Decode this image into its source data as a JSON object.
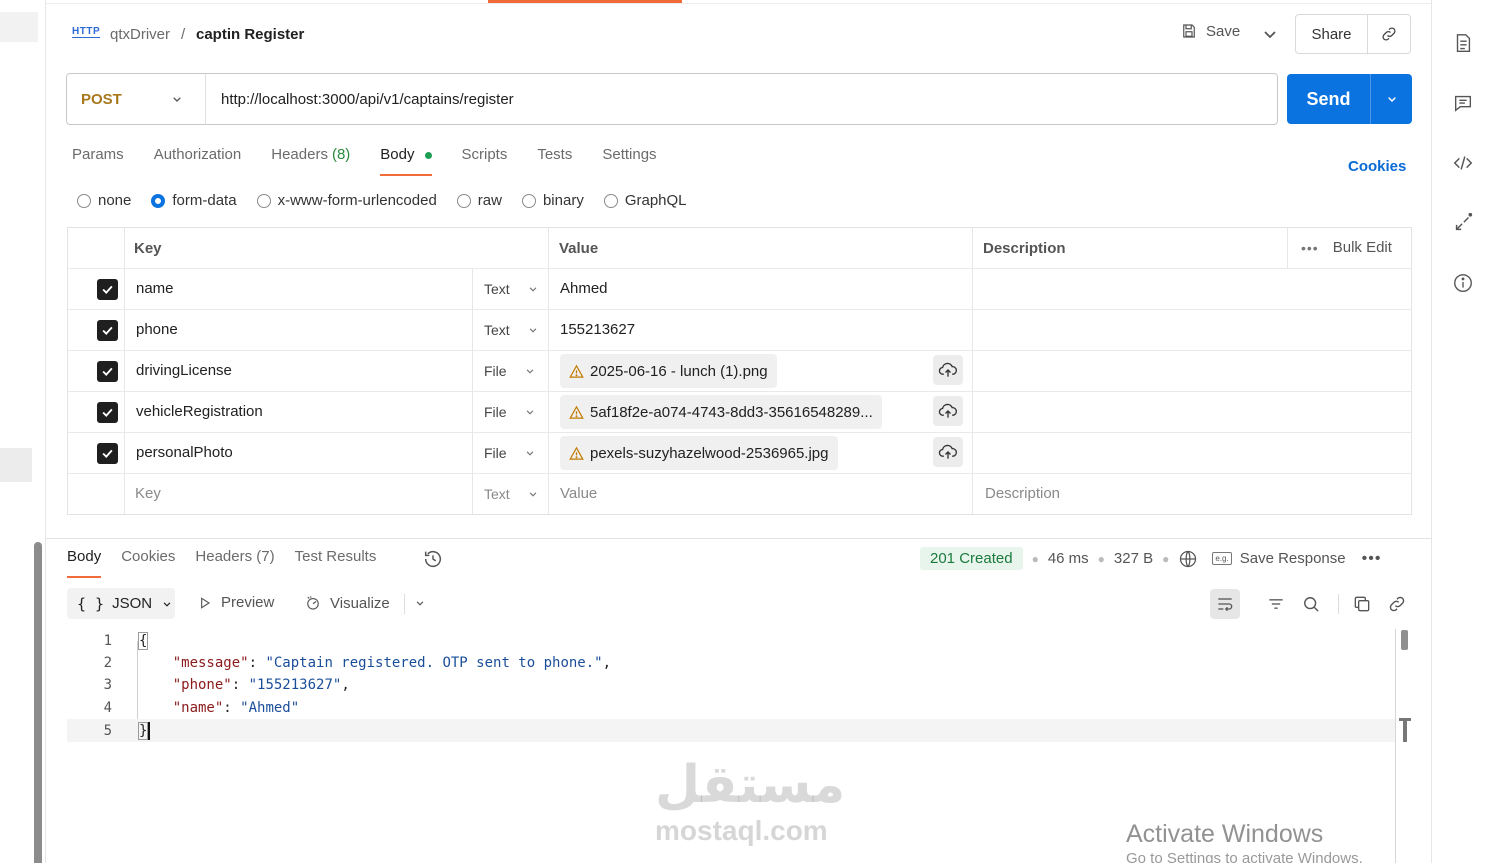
{
  "header": {
    "http_badge": "HTTP",
    "collection": "qtxDriver",
    "separator": "/",
    "request_name": "captin Register",
    "save_label": "Save",
    "share_label": "Share"
  },
  "request": {
    "method": "POST",
    "url": "http://localhost:3000/api/v1/captains/register",
    "send_label": "Send"
  },
  "request_tabs": [
    {
      "label": "Params",
      "count": ""
    },
    {
      "label": "Authorization",
      "count": ""
    },
    {
      "label": "Headers",
      "count": "(8)"
    },
    {
      "label": "Body",
      "count": ""
    },
    {
      "label": "Scripts",
      "count": ""
    },
    {
      "label": "Tests",
      "count": ""
    },
    {
      "label": "Settings",
      "count": ""
    }
  ],
  "cookies_label": "Cookies",
  "body_modes": [
    {
      "label": "none",
      "selected": false
    },
    {
      "label": "form-data",
      "selected": true
    },
    {
      "label": "x-www-form-urlencoded",
      "selected": false
    },
    {
      "label": "raw",
      "selected": false
    },
    {
      "label": "binary",
      "selected": false
    },
    {
      "label": "GraphQL",
      "selected": false
    }
  ],
  "form_table": {
    "headers": {
      "key": "Key",
      "value": "Value",
      "description": "Description",
      "bulk_edit": "Bulk Edit",
      "more": "•••"
    },
    "rows": [
      {
        "key": "name",
        "type": "Text",
        "value": "Ahmed",
        "checked": true
      },
      {
        "key": "phone",
        "type": "Text",
        "value": "155213627",
        "checked": true
      },
      {
        "key": "drivingLicense",
        "type": "File",
        "value": "2025-06-16 - lunch (1).png",
        "checked": true
      },
      {
        "key": "vehicleRegistration",
        "type": "File",
        "value": "5af18f2e-a074-4743-8dd3-35616548289...",
        "checked": true
      },
      {
        "key": "personalPhoto",
        "type": "File",
        "value": "pexels-suzyhazelwood-2536965.jpg",
        "checked": true
      }
    ],
    "placeholder_row": {
      "key": "Key",
      "type": "Text",
      "value": "Value",
      "description": "Description"
    }
  },
  "response_tabs": [
    {
      "label": "Body",
      "count": ""
    },
    {
      "label": "Cookies",
      "count": ""
    },
    {
      "label": "Headers",
      "count": "(7)"
    },
    {
      "label": "Test Results",
      "count": ""
    }
  ],
  "response_meta": {
    "status": "201 Created",
    "time": "46 ms",
    "size": "327 B",
    "save_response": "Save Response",
    "save_response_badge": "e.g.",
    "more": "•••",
    "status_color": "#1b7a3c"
  },
  "response_toolbar": {
    "format": "JSON",
    "format_icon": "{ }",
    "preview": "Preview",
    "visualize": "Visualize"
  },
  "response_code": {
    "line_numbers": [
      "1",
      "2",
      "3",
      "4",
      "5"
    ],
    "open_brace": "{",
    "close_brace": "}",
    "pairs": [
      {
        "key": "\"message\"",
        "value": "\"Captain registered. OTP sent to phone.\"",
        "trail": ","
      },
      {
        "key": "\"phone\"",
        "value": "\"155213627\"",
        "trail": ","
      },
      {
        "key": "\"name\"",
        "value": "\"Ahmed\"",
        "trail": ""
      }
    ]
  },
  "watermark": {
    "arabic": "مستقل",
    "latin": "mostaql.com"
  },
  "os_overlay": {
    "title": "Activate Windows",
    "subtitle": "Go to Settings to activate Windows."
  },
  "colors": {
    "accent_orange": "#f26b3a",
    "send_blue": "#0a73e0",
    "method_post": "#a8791c"
  }
}
